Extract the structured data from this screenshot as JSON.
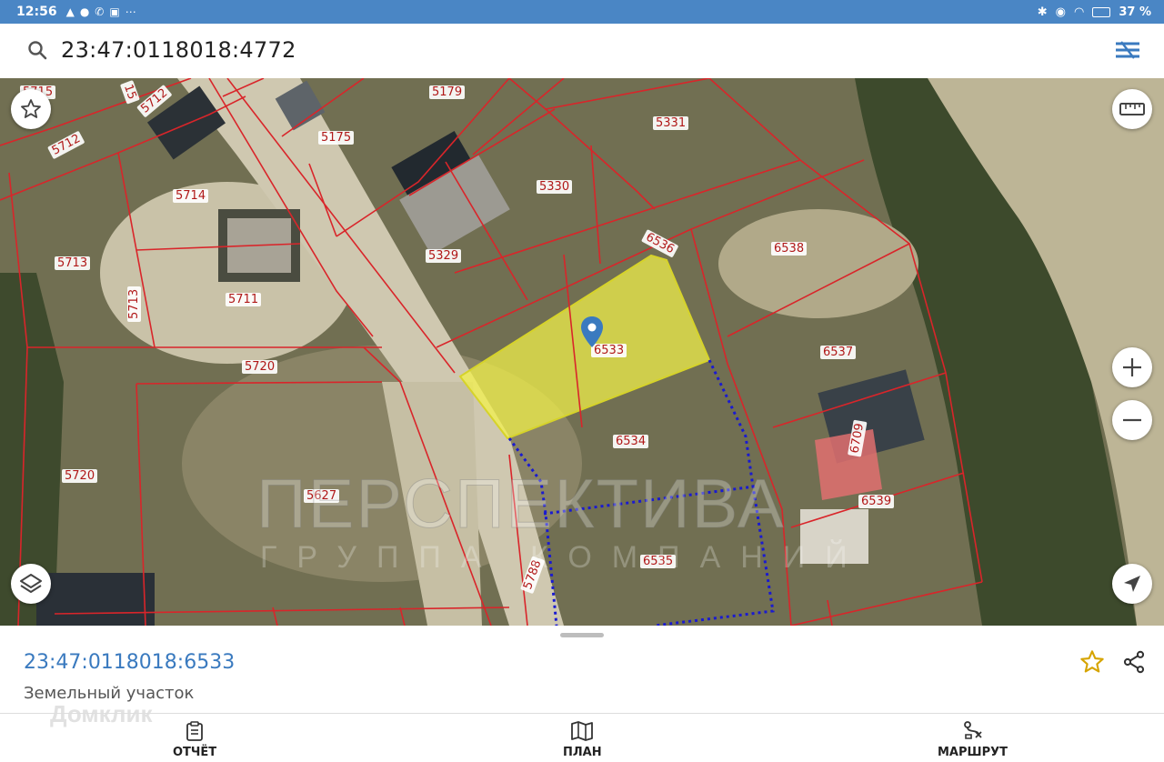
{
  "status_bar": {
    "time": "12:56",
    "battery": "37 %"
  },
  "search": {
    "query": "23:47:0118018:4772"
  },
  "map": {
    "parcel_labels": [
      {
        "text": "5715"
      },
      {
        "text": "15"
      },
      {
        "text": "5712"
      },
      {
        "text": "5712"
      },
      {
        "text": "5179"
      },
      {
        "text": "5175"
      },
      {
        "text": "5331"
      },
      {
        "text": "5714"
      },
      {
        "text": "5330"
      },
      {
        "text": "6536"
      },
      {
        "text": "6538"
      },
      {
        "text": "5713"
      },
      {
        "text": "5329"
      },
      {
        "text": "5711"
      },
      {
        "text": "5713"
      },
      {
        "text": "6533"
      },
      {
        "text": "6537"
      },
      {
        "text": "5720"
      },
      {
        "text": "6534"
      },
      {
        "text": "6709"
      },
      {
        "text": "5720"
      },
      {
        "text": "5627"
      },
      {
        "text": "6539"
      },
      {
        "text": "6535"
      },
      {
        "text": "5788"
      }
    ],
    "watermark_title": "ПЕРСПЕКТИВА",
    "watermark_subtitle": "ГРУППА КОМПАНИЙ",
    "highlight_color": "#f4f34a",
    "parcel_line_color": "#d9252a",
    "dotted_line_color": "#1a1ad0"
  },
  "card": {
    "parcel_number": "23:47:0118018:6533",
    "parcel_type": "Земельный участок",
    "watermark": "Домклик"
  },
  "nav": {
    "report": "ОТЧЁТ",
    "plan": "ПЛАН",
    "route": "МАРШРУТ"
  }
}
